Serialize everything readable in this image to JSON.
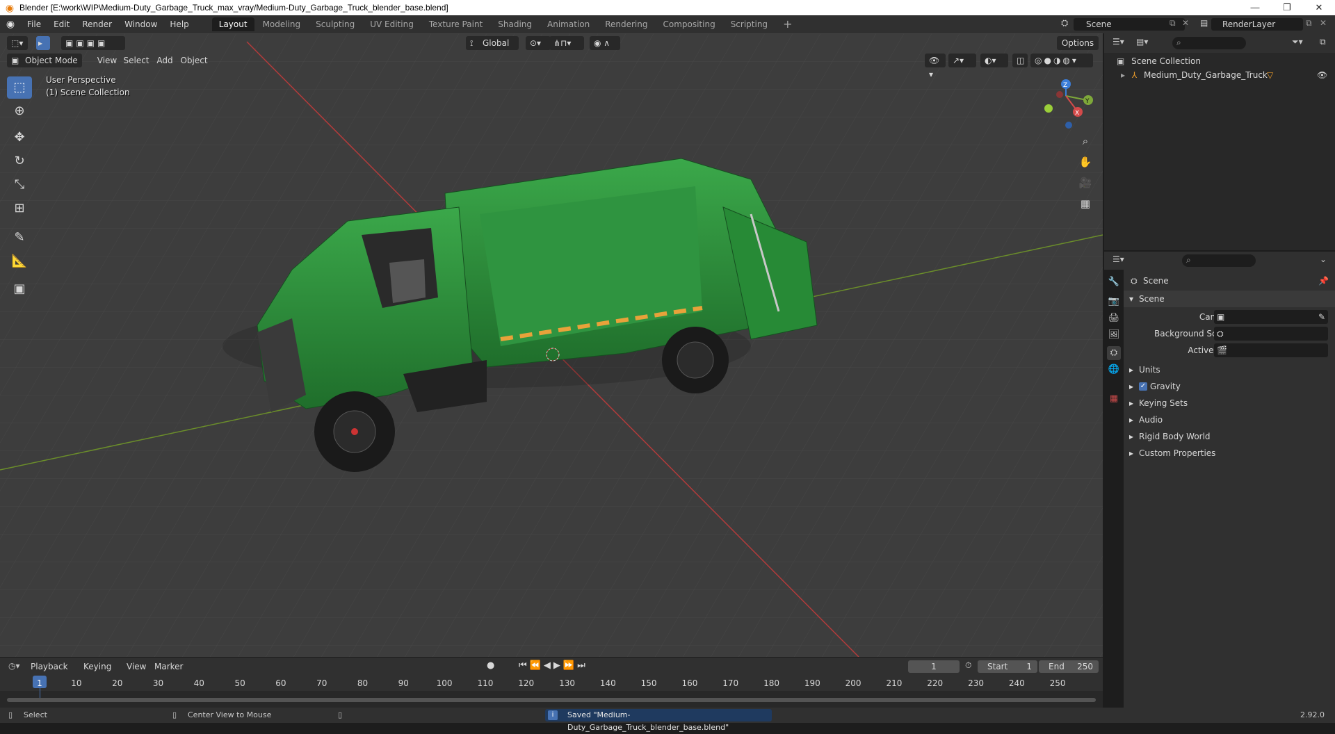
{
  "window": {
    "title": "Blender [E:\\work\\WIP\\Medium-Duty_Garbage_Truck_max_vray/Medium-Duty_Garbage_Truck_blender_base.blend]",
    "minimize": "—",
    "maximize": "❐",
    "close": "✕"
  },
  "menu": [
    "File",
    "Edit",
    "Render",
    "Window",
    "Help"
  ],
  "workspaces": [
    "Layout",
    "Modeling",
    "Sculpting",
    "UV Editing",
    "Texture Paint",
    "Shading",
    "Animation",
    "Rendering",
    "Compositing",
    "Scripting"
  ],
  "add_workspace": "+",
  "scene_name": "Scene",
  "view_layer": "RenderLayer",
  "viewport": {
    "mode": "Object Mode",
    "menus": [
      "View",
      "Select",
      "Add",
      "Object"
    ],
    "transform_orientation": "Global",
    "options": "Options",
    "perspective_label": "User Perspective",
    "collection_label": "(1) Scene Collection",
    "gizmo": {
      "z": "Z",
      "y": "Y",
      "x": "X"
    }
  },
  "outliner": {
    "root": "Scene Collection",
    "items": [
      {
        "name": "Medium_Duty_Garbage_Truck"
      }
    ]
  },
  "properties": {
    "context_label": "Scene",
    "panel_title": "Scene",
    "fields": [
      {
        "label": "Camera"
      },
      {
        "label": "Background Scene"
      },
      {
        "label": "Active Clip"
      }
    ],
    "subpanels": [
      {
        "label": "Units",
        "checkbox": false
      },
      {
        "label": "Gravity",
        "checkbox": true
      },
      {
        "label": "Keying Sets",
        "checkbox": false
      },
      {
        "label": "Audio",
        "checkbox": false
      },
      {
        "label": "Rigid Body World",
        "checkbox": false
      },
      {
        "label": "Custom Properties",
        "checkbox": false
      }
    ]
  },
  "timeline": {
    "menus": [
      "Playback",
      "Keying",
      "View",
      "Marker"
    ],
    "current_frame": "1",
    "start_label": "Start",
    "start": "1",
    "end_label": "End",
    "end": "250",
    "ruler": [
      "1",
      "10",
      "20",
      "30",
      "40",
      "50",
      "60",
      "70",
      "80",
      "90",
      "100",
      "110",
      "120",
      "130",
      "140",
      "150",
      "160",
      "170",
      "180",
      "190",
      "200",
      "210",
      "220",
      "230",
      "240",
      "250"
    ]
  },
  "status": {
    "left_action": "Select",
    "middle_action": "Center View to Mouse",
    "message": "Saved \"Medium-Duty_Garbage_Truck_blender_base.blend\"",
    "version": "2.92.0"
  },
  "colors": {
    "accent": "#4772b3",
    "truck_green": "#2e8b3a",
    "x_axis": "#d44a4a",
    "y_axis": "#7ea83a",
    "z_axis": "#3b7ed9"
  }
}
